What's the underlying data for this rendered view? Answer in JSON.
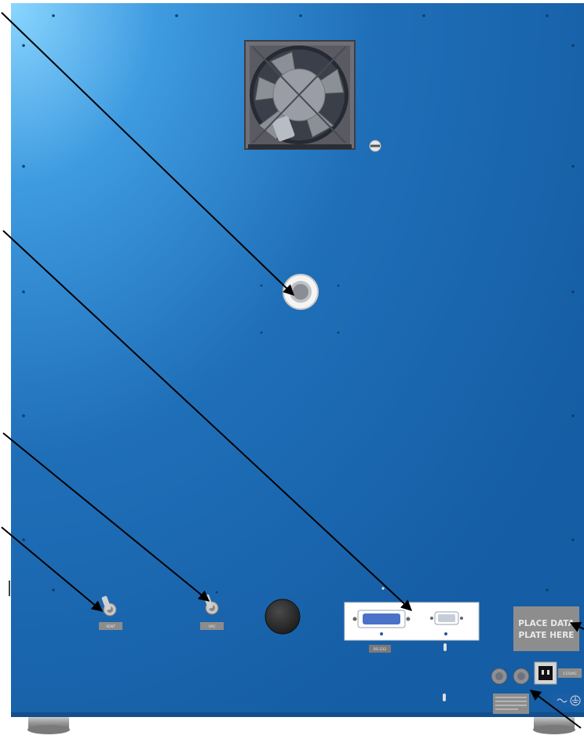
{
  "data_plate": {
    "line1": "PLACE DATA",
    "line2": "PLATE HERE"
  },
  "labels": {
    "switch_left": "VENT",
    "switch_right": "VAC",
    "serial_port": "RS-232",
    "power_rating": "115VAC"
  },
  "colors": {
    "panel": "#1f6fb8",
    "panel_highlight": "#6ec8f7",
    "panel_shadow": "#145a9c",
    "arrow": "#000000"
  }
}
